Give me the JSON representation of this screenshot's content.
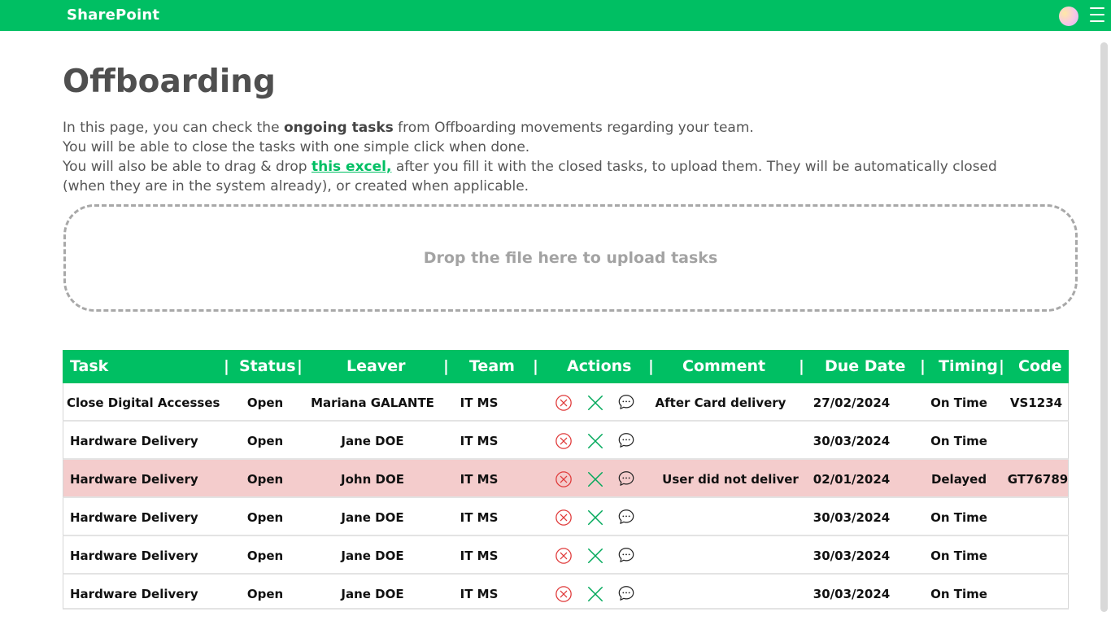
{
  "app": {
    "brand": "SharePoint"
  },
  "page": {
    "title": "Offboarding",
    "intro": {
      "line1_pre": "In this page, you can check the ",
      "line1_bold": "ongoing tasks",
      "line1_post": " from Offboarding movements regarding your team.",
      "line2": "You will be able to close the tasks with one simple click when done.",
      "line3_pre": "You will also be able to drag & drop ",
      "line3_link": "this excel,",
      "line3_post": " after you fill it with the closed tasks, to upload them. They will be automatically closed (when they are in the system already), or created when applicable."
    },
    "dropzone_text": "Drop the file here to upload tasks"
  },
  "table": {
    "headers": [
      "Task",
      "Status",
      "Leaver",
      "Team",
      "Actions",
      "Comment",
      "Due Date",
      "Timing",
      "Code"
    ],
    "separator": "|",
    "rows": [
      {
        "task": "Close Digital Accesses",
        "status": "Open",
        "leaver": "Mariana GALANTE",
        "team": "IT MS",
        "comment": "After Card delivery",
        "due": "27/02/2024",
        "timing": "On Time",
        "code": "VS1234"
      },
      {
        "task": "Hardware Delivery",
        "status": "Open",
        "leaver": "Jane DOE",
        "team": "IT MS",
        "comment": "",
        "due": "30/03/2024",
        "timing": "On Time",
        "code": ""
      },
      {
        "task": "Hardware Delivery",
        "status": "Open",
        "leaver": "John DOE",
        "team": "IT MS",
        "comment": "User did not deliver",
        "due": "02/01/2024",
        "timing": "Delayed",
        "code": "GT76789"
      },
      {
        "task": "Hardware Delivery",
        "status": "Open",
        "leaver": "Jane DOE",
        "team": "IT MS",
        "comment": "",
        "due": "30/03/2024",
        "timing": "On Time",
        "code": ""
      },
      {
        "task": "Hardware Delivery",
        "status": "Open",
        "leaver": "Jane DOE",
        "team": "IT MS",
        "comment": "",
        "due": "30/03/2024",
        "timing": "On Time",
        "code": ""
      },
      {
        "task": "Hardware Delivery",
        "status": "Open",
        "leaver": "Jane DOE",
        "team": "IT MS",
        "comment": "",
        "due": "30/03/2024",
        "timing": "On Time",
        "code": ""
      }
    ],
    "actions_icons": [
      "cancel-circle-icon",
      "close-x-icon",
      "comment-bubble-icon"
    ]
  },
  "colors": {
    "brand_green": "#00bf63",
    "delayed_row": "#f4cccc",
    "cancel_icon": "#e03b3b",
    "close_icon": "#00a85a"
  }
}
